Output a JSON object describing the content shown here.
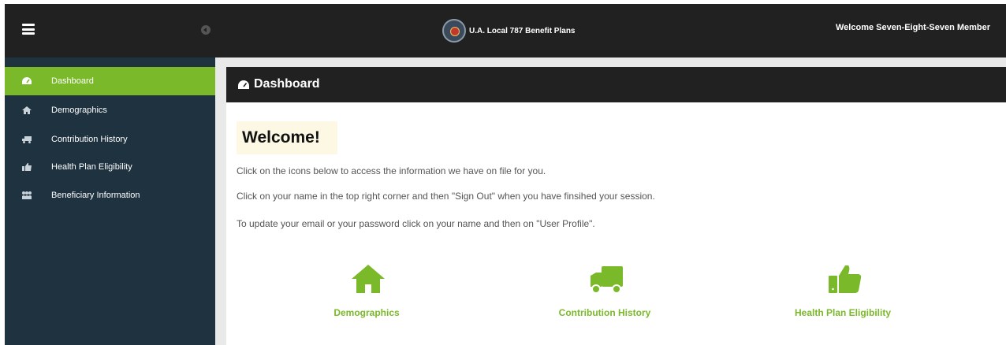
{
  "header": {
    "brand_name": "U.A. Local 787 Benefit Plans",
    "welcome_user": "Welcome Seven-Eight-Seven Member",
    "icons": [
      "menu-icon",
      "circle-arrow-left-icon",
      "union-logo"
    ]
  },
  "sidebar": {
    "items": [
      {
        "label": "Dashboard",
        "icon": "dashboard-icon",
        "active": true
      },
      {
        "label": "Demographics",
        "icon": "home-icon",
        "active": false
      },
      {
        "label": "Contribution History",
        "icon": "truck-icon",
        "active": false
      },
      {
        "label": "Health Plan Eligibility",
        "icon": "thumbs-up-icon",
        "active": false
      },
      {
        "label": "Beneficiary Information",
        "icon": "users-icon",
        "active": false
      }
    ]
  },
  "main": {
    "panel_title": "Dashboard",
    "welcome_heading": "Welcome!",
    "paragraphs": [
      "Click on the icons below to access the information we have on file for you.",
      "Click on your name in the top right corner and then \"Sign Out\" when you have finsihed your session.",
      "To update your email or your password click on your name and then on \"User Profile\"."
    ],
    "tiles": [
      {
        "label": "Demographics",
        "icon": "home-icon"
      },
      {
        "label": "Contribution History",
        "icon": "truck-icon"
      },
      {
        "label": "Health Plan Eligibility",
        "icon": "thumbs-up-icon"
      }
    ]
  },
  "colors": {
    "accent_green": "#7ab929",
    "topbar": "#212121",
    "sidebar": "#1f3240"
  }
}
